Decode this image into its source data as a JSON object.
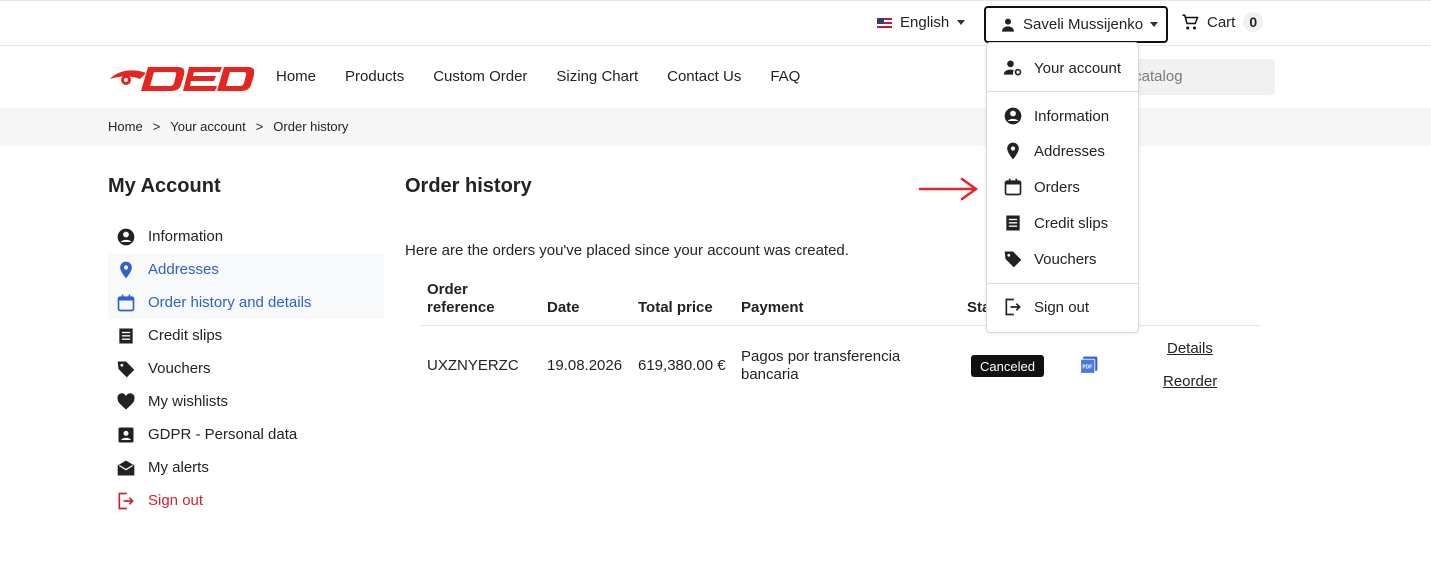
{
  "topbar": {
    "language": "English",
    "user_name": "Saveli Mussijenko",
    "cart_label": "Cart",
    "cart_count": "0"
  },
  "header": {
    "nav": [
      "Home",
      "Products",
      "Custom Order",
      "Sizing Chart",
      "Contact Us",
      "FAQ"
    ],
    "search_placeholder": "r catalog"
  },
  "breadcrumb": [
    "Home",
    ">",
    "Your account",
    ">",
    "Order history"
  ],
  "sidebar": {
    "title": "My Account",
    "items": [
      "Information",
      "Addresses",
      "Order history and details",
      "Credit slips",
      "Vouchers",
      "My wishlists",
      "GDPR - Personal data",
      "My alerts",
      "Sign out"
    ]
  },
  "main": {
    "title": "Order history",
    "intro": "Here are the orders you've placed since your account was created.",
    "headers": [
      "Order reference",
      "Date",
      "Total price",
      "Payment",
      "Sta"
    ],
    "order": {
      "reference": "UXZNYERZC",
      "date": "19.08.2026",
      "total": "619,380.00 €",
      "payment": "Pagos por transferencia bancaria",
      "status": "Canceled",
      "details": "Details",
      "reorder": "Reorder"
    }
  },
  "dropdown": {
    "items": [
      "Your account",
      "Information",
      "Addresses",
      "Orders",
      "Credit slips",
      "Vouchers",
      "Sign out"
    ]
  },
  "colors": {
    "accent": "#2f61c8",
    "danger": "#cc2330",
    "brand_red": "#e52620",
    "badge": "#111111"
  }
}
